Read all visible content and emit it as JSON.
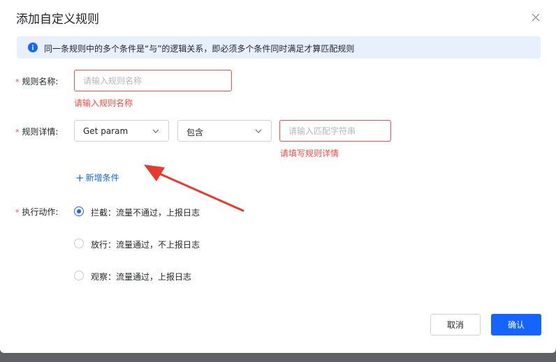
{
  "dialog": {
    "title": "添加自定义规则",
    "info": "同一条规则中的多个条件是“与”的逻辑关系，即必须多个条件同时满足才算匹配规则"
  },
  "form": {
    "required_mark": "*",
    "name": {
      "label": "规则名称:",
      "placeholder": "请输入规则名称",
      "value": "",
      "error": "请输入规则名称"
    },
    "detail": {
      "label": "规则详情:",
      "field_select": "Get param",
      "operator_select": "包含",
      "match_placeholder": "请输入匹配字符串",
      "match_value": "",
      "error": "请填写规则详情",
      "add_condition": "新增条件"
    },
    "action": {
      "label": "执行动作:",
      "options": [
        {
          "label": "拦截：流量不通过，上报日志",
          "selected": true
        },
        {
          "label": "放行：流量通过，不上报日志",
          "selected": false
        },
        {
          "label": "观察：流量通过，上报日志",
          "selected": false
        }
      ]
    }
  },
  "footer": {
    "cancel": "取消",
    "confirm": "确认"
  },
  "colors": {
    "primary": "#1664ff",
    "error": "#f54a45",
    "info_bg": "#e8f0fd",
    "annotation_arrow": "#e63a2e"
  }
}
